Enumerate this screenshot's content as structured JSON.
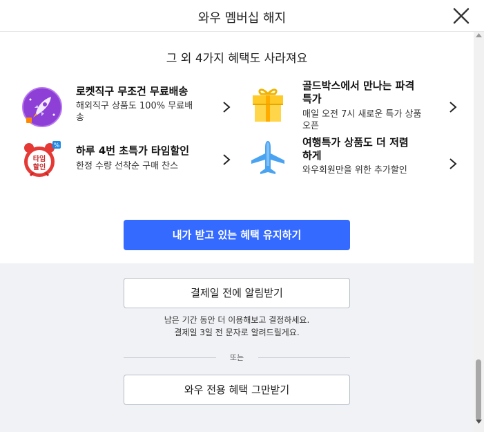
{
  "header": {
    "title": "와우 멤버십 해지"
  },
  "section": {
    "heading": "그 외 4가지 혜택도 사라져요"
  },
  "benefits": [
    {
      "title": "로켓직구 무조건 무료배송",
      "desc_line1": "해외직구 상품도 100% 무료배",
      "desc_line2": "송",
      "icon": "rocket-icon"
    },
    {
      "title_line1": "골드박스에서 만나는 파격",
      "title_line2": "특가",
      "desc_line1": "매일 오전 7시 새로운 특가 상품",
      "desc_line2": "오픈",
      "icon": "gift-box-icon"
    },
    {
      "title": "하루 4번 초특가 타임할인",
      "desc": "한정 수량 선착순 구매 찬스",
      "icon": "alarm-clock-icon",
      "clock_text_line1": "타임",
      "clock_text_line2": "할인",
      "badge": "%"
    },
    {
      "title_line1": "여행특가 상품도 더 저렴",
      "title_line2": "하게",
      "desc": "와우회원만을 위한 추가할인",
      "icon": "airplane-icon"
    }
  ],
  "actions": {
    "keep_label": "내가 받고 있는 혜택 유지하기",
    "remind_label": "결제일 전에 알림받기",
    "notice_line1": "남은 기간 동안 더 이용해보고 결정하세요.",
    "notice_line2": "결제일 3일 전 문자로 알려드릴게요.",
    "or_label": "또는",
    "stop_label": "와우 전용 혜택 그만받기"
  },
  "colors": {
    "primary": "#346aff",
    "grey_bg": "#f1f2f5"
  }
}
